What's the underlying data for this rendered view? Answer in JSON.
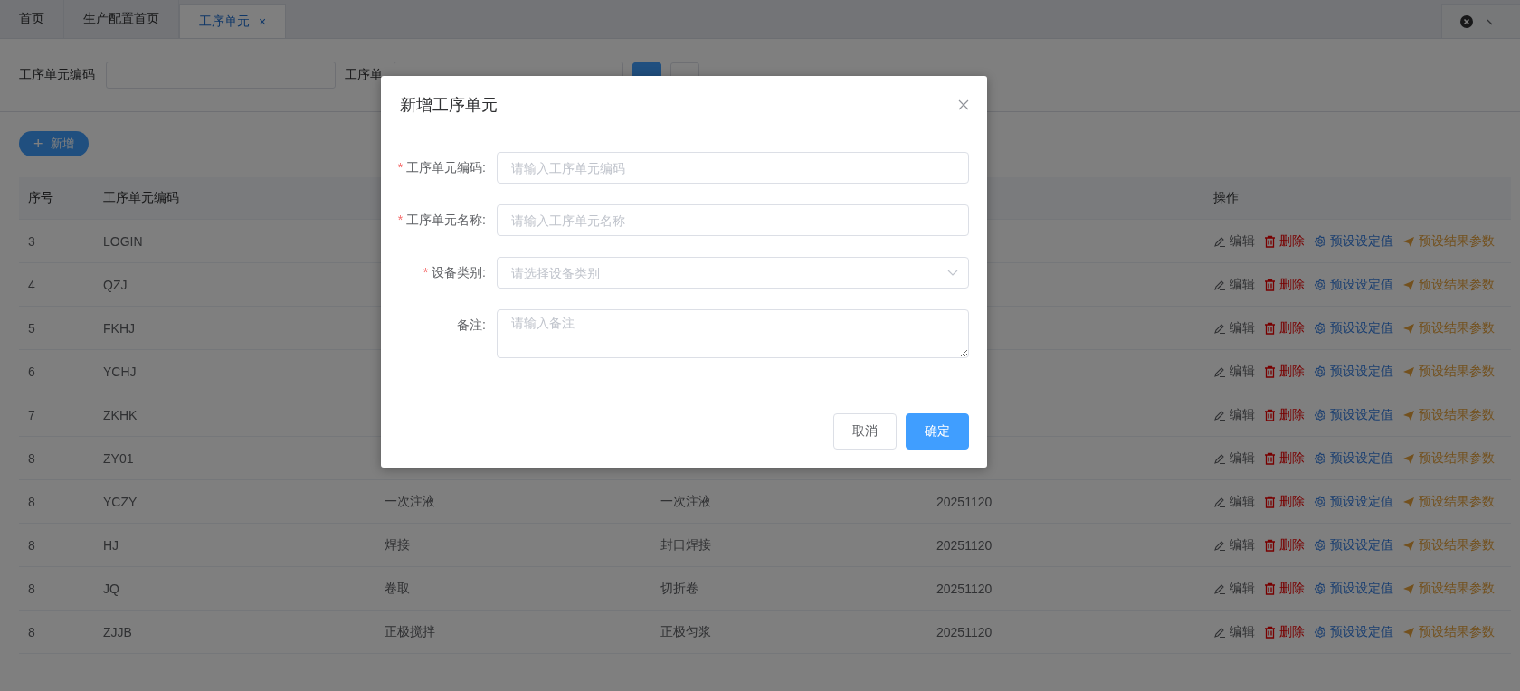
{
  "tabs": [
    {
      "label": "首页",
      "selected": false,
      "closable": false
    },
    {
      "label": "生产配置首页",
      "selected": false,
      "closable": false
    },
    {
      "label": "工序单元",
      "selected": true,
      "closable": true,
      "close": "×"
    }
  ],
  "filters": {
    "fields": [
      {
        "label": "工序单元编码"
      },
      {
        "label": "工序单"
      }
    ],
    "buttons": [
      {
        "kind": "primary"
      },
      {
        "kind": "default"
      }
    ]
  },
  "add_button": {
    "icon": "+",
    "label": "新增"
  },
  "table": {
    "columns": [
      "序号",
      "工序单元编码",
      "操作"
    ],
    "rows": [
      {
        "cells": [
          "3",
          "LOGIN"
        ],
        "actions": [
          {
            "kind": "edit",
            "label": "编辑"
          },
          {
            "kind": "delete",
            "label": "删除"
          },
          {
            "kind": "preset",
            "label": "预设设定值"
          },
          {
            "kind": "result",
            "label": "预设结果参数"
          }
        ]
      },
      {
        "cells": [
          "4",
          "QZJ"
        ],
        "actions": [
          {
            "kind": "edit",
            "label": "编辑"
          },
          {
            "kind": "delete",
            "label": "删除"
          },
          {
            "kind": "preset",
            "label": "预设设定值"
          },
          {
            "kind": "result",
            "label": "预设结果参数"
          }
        ]
      },
      {
        "cells": [
          "5",
          "FKHJ"
        ],
        "actions": [
          {
            "kind": "edit",
            "label": "编辑"
          },
          {
            "kind": "delete",
            "label": "删除"
          },
          {
            "kind": "preset",
            "label": "预设设定值"
          },
          {
            "kind": "result",
            "label": "预设结果参数"
          }
        ]
      },
      {
        "cells": [
          "6",
          "YCHJ"
        ],
        "actions": [
          {
            "kind": "edit",
            "label": "编辑"
          },
          {
            "kind": "delete",
            "label": "删除"
          },
          {
            "kind": "preset",
            "label": "预设设定值"
          },
          {
            "kind": "result",
            "label": "预设结果参数"
          }
        ]
      },
      {
        "cells": [
          "7",
          "ZKHK"
        ],
        "actions": [
          {
            "kind": "edit",
            "label": "编辑"
          },
          {
            "kind": "delete",
            "label": "删除"
          },
          {
            "kind": "preset",
            "label": "预设设定值"
          },
          {
            "kind": "result",
            "label": "预设结果参数"
          }
        ]
      },
      {
        "cells": [
          "8",
          "ZY01"
        ],
        "actions": [
          {
            "kind": "edit",
            "label": "编辑"
          },
          {
            "kind": "delete",
            "label": "删除"
          },
          {
            "kind": "preset",
            "label": "预设设定值"
          },
          {
            "kind": "result",
            "label": "预设结果参数"
          }
        ]
      },
      {
        "cells": [
          "8",
          "YCZY",
          "一次注液",
          "一次注液",
          "20251120"
        ],
        "actions": [
          {
            "kind": "edit",
            "label": "编辑"
          },
          {
            "kind": "delete",
            "label": "删除"
          },
          {
            "kind": "preset",
            "label": "预设设定值"
          },
          {
            "kind": "result",
            "label": "预设结果参数"
          }
        ]
      },
      {
        "cells": [
          "8",
          "HJ",
          "焊接",
          "封口焊接",
          "20251120"
        ],
        "actions": [
          {
            "kind": "edit",
            "label": "编辑"
          },
          {
            "kind": "delete",
            "label": "删除"
          },
          {
            "kind": "preset",
            "label": "预设设定值"
          },
          {
            "kind": "result",
            "label": "预设结果参数"
          }
        ]
      },
      {
        "cells": [
          "8",
          "JQ",
          "卷取",
          "切折卷",
          "20251120"
        ],
        "actions": [
          {
            "kind": "edit",
            "label": "编辑"
          },
          {
            "kind": "delete",
            "label": "删除"
          },
          {
            "kind": "preset",
            "label": "预设设定值"
          },
          {
            "kind": "result",
            "label": "预设结果参数"
          }
        ]
      },
      {
        "cells": [
          "8",
          "ZJJB",
          "正极搅拌",
          "正极匀浆",
          "20251120"
        ],
        "actions": [
          {
            "kind": "edit",
            "label": "编辑"
          },
          {
            "kind": "delete",
            "label": "删除"
          },
          {
            "kind": "preset",
            "label": "预设设定值"
          },
          {
            "kind": "result",
            "label": "预设结果参数"
          }
        ]
      }
    ]
  },
  "dialog": {
    "title": "新增工序单元",
    "required_mark": "*",
    "fields": [
      {
        "kind": "input",
        "label": "工序单元编码:",
        "required": true,
        "placeholder": "请输入工序单元编码"
      },
      {
        "kind": "input",
        "label": "工序单元名称:",
        "required": true,
        "placeholder": "请输入工序单元名称"
      },
      {
        "kind": "select",
        "label": "设备类别:",
        "required": true,
        "placeholder": "请选择设备类别"
      },
      {
        "kind": "textarea",
        "label": "备注:",
        "required": false,
        "placeholder": "请输入备注"
      }
    ],
    "buttons": [
      {
        "label": "取消",
        "kind": "default"
      },
      {
        "label": "确定",
        "kind": "primary"
      }
    ]
  }
}
